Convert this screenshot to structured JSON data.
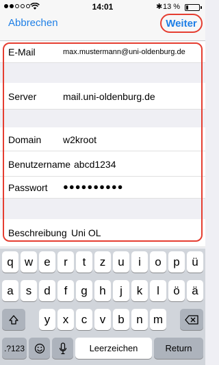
{
  "status_bar": {
    "time": "14:01",
    "battery_pct": "13 %",
    "battery_level": 0.13,
    "signal_dots_filled": 2,
    "signal_dots_total": 5
  },
  "nav": {
    "cancel_label": "Abbrechen",
    "next_label": "Weiter",
    "accent_color": "#1e7fe6",
    "highlight_color": "#e53d30"
  },
  "form": {
    "email": {
      "label": "E-Mail",
      "value": "max.mustermann@uni-oldenburg.de"
    },
    "server": {
      "label": "Server",
      "value": "mail.uni-oldenburg.de"
    },
    "domain": {
      "label": "Domain",
      "value": "w2kroot"
    },
    "username": {
      "label": "Benutzername",
      "value": "abcd1234"
    },
    "password": {
      "label": "Passwort",
      "value": "●●●●●●●●●●"
    },
    "description": {
      "label": "Beschreibung",
      "value": "Uni OL"
    }
  },
  "keyboard": {
    "row1": [
      "q",
      "w",
      "e",
      "r",
      "t",
      "z",
      "u",
      "i",
      "o",
      "p",
      "ü"
    ],
    "row2": [
      "a",
      "s",
      "d",
      "f",
      "g",
      "h",
      "j",
      "k",
      "l",
      "ö",
      "ä"
    ],
    "row3": [
      "y",
      "x",
      "c",
      "v",
      "b",
      "n",
      "m"
    ],
    "shift_icon": "shift-icon",
    "backspace_icon": "backspace-icon",
    "numbers_label": ".?123",
    "emoji_icon": "emoji-icon",
    "mic_icon": "microphone-icon",
    "space_label": "Leerzeichen",
    "return_label": "Return"
  }
}
